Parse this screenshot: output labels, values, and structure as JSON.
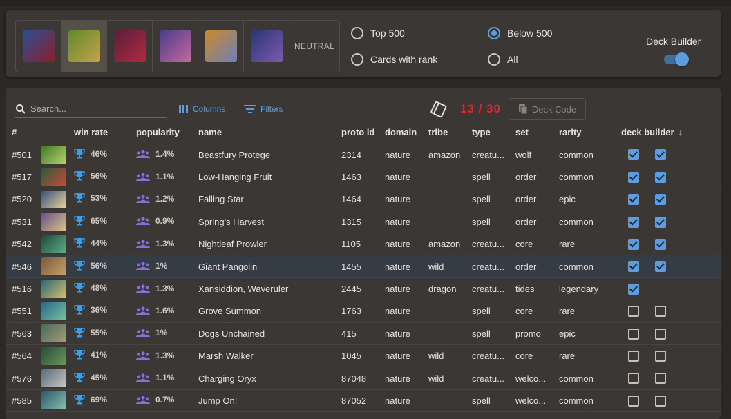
{
  "heroes": [
    {
      "name": "hero-1",
      "color": "#2b4f93",
      "color2": "#8a1e2a",
      "selected": false
    },
    {
      "name": "hero-2",
      "color": "#5f8a2e",
      "color2": "#c7a24a",
      "selected": true
    },
    {
      "name": "hero-3",
      "color": "#5a1f3a",
      "color2": "#b02a40",
      "selected": false
    },
    {
      "name": "hero-4",
      "color": "#4b3a8c",
      "color2": "#c46a9e",
      "selected": false
    },
    {
      "name": "hero-5",
      "color": "#c98a2a",
      "color2": "#6f7fb8",
      "selected": false
    },
    {
      "name": "hero-6",
      "color": "#2c3470",
      "color2": "#7a5bb0",
      "selected": false
    }
  ],
  "neutral_label": "NEUTRAL",
  "filters": {
    "top500": "Top 500",
    "below500": "Below 500",
    "cards_with_rank": "Cards with rank",
    "all": "All",
    "selected": "below500"
  },
  "deck_builder": {
    "title": "Deck Builder",
    "enabled": true
  },
  "toolbar": {
    "search_placeholder": "Search...",
    "columns_label": "Columns",
    "filters_label": "Filters",
    "deck_count": "13 / 30",
    "deck_code_label": "Deck Code"
  },
  "colors": {
    "accent": "#5b9de0",
    "count": "#e0262a",
    "trophy": "#3b9fe8",
    "people": "#8a6fd6"
  },
  "table": {
    "headers": {
      "num": "#",
      "win_rate": "win rate",
      "popularity": "popularity",
      "name": "name",
      "proto_id": "proto id",
      "domain": "domain",
      "tribe": "tribe",
      "type": "type",
      "set": "set",
      "rarity": "rarity",
      "deck_builder": "deck builder"
    },
    "rows": [
      {
        "num": "#501",
        "win": "46%",
        "pop": "1.4%",
        "name": "Beastfury Protege",
        "proto": "2314",
        "domain": "nature",
        "tribe": "amazon",
        "type": "creatu...",
        "set": "wolf",
        "rarity": "common",
        "cb1": true,
        "cb2": true,
        "c1": "#3f7a2a",
        "c2": "#b8d16a"
      },
      {
        "num": "#517",
        "win": "56%",
        "pop": "1.1%",
        "name": "Low-Hanging Fruit",
        "proto": "1463",
        "domain": "nature",
        "tribe": "",
        "type": "spell",
        "set": "order",
        "rarity": "common",
        "cb1": true,
        "cb2": true,
        "c1": "#2f5a3a",
        "c2": "#c94a3a"
      },
      {
        "num": "#520",
        "win": "53%",
        "pop": "1.2%",
        "name": "Falling Star",
        "proto": "1464",
        "domain": "nature",
        "tribe": "",
        "type": "spell",
        "set": "order",
        "rarity": "epic",
        "cb1": true,
        "cb2": true,
        "c1": "#3a4f7a",
        "c2": "#e8d79a"
      },
      {
        "num": "#531",
        "win": "65%",
        "pop": "0.9%",
        "name": "Spring's Harvest",
        "proto": "1315",
        "domain": "nature",
        "tribe": "",
        "type": "spell",
        "set": "order",
        "rarity": "common",
        "cb1": true,
        "cb2": true,
        "c1": "#6a4f8a",
        "c2": "#d9c38a"
      },
      {
        "num": "#542",
        "win": "44%",
        "pop": "1.3%",
        "name": "Nightleaf Prowler",
        "proto": "1105",
        "domain": "nature",
        "tribe": "amazon",
        "type": "creatu...",
        "set": "core",
        "rarity": "rare",
        "cb1": true,
        "cb2": true,
        "c1": "#1f4a3a",
        "c2": "#5fae8a"
      },
      {
        "num": "#546",
        "win": "56%",
        "pop": "1%",
        "name": "Giant Pangolin",
        "proto": "1455",
        "domain": "nature",
        "tribe": "wild",
        "type": "creatu...",
        "set": "order",
        "rarity": "common",
        "cb1": true,
        "cb2": true,
        "c1": "#7a5a3a",
        "c2": "#c9a06a",
        "hl": true
      },
      {
        "num": "#516",
        "win": "48%",
        "pop": "1.3%",
        "name": "Xansiddion, Waveruler",
        "proto": "2445",
        "domain": "nature",
        "tribe": "dragon",
        "type": "creatu...",
        "set": "tides",
        "rarity": "legendary",
        "cb1": true,
        "cb2": null,
        "c1": "#2a6a7a",
        "c2": "#d4c06a"
      },
      {
        "num": "#551",
        "win": "36%",
        "pop": "1.6%",
        "name": "Grove Summon",
        "proto": "1763",
        "domain": "nature",
        "tribe": "",
        "type": "spell",
        "set": "core",
        "rarity": "rare",
        "cb1": false,
        "cb2": false,
        "c1": "#2a6a8a",
        "c2": "#7ac0a0"
      },
      {
        "num": "#563",
        "win": "55%",
        "pop": "1%",
        "name": "Dogs Unchained",
        "proto": "415",
        "domain": "nature",
        "tribe": "",
        "type": "spell",
        "set": "promo",
        "rarity": "epic",
        "cb1": false,
        "cb2": false,
        "c1": "#4a6a5a",
        "c2": "#a89a7a"
      },
      {
        "num": "#564",
        "win": "41%",
        "pop": "1.3%",
        "name": "Marsh Walker",
        "proto": "1045",
        "domain": "nature",
        "tribe": "wild",
        "type": "creatu...",
        "set": "core",
        "rarity": "rare",
        "cb1": false,
        "cb2": false,
        "c1": "#2a4a3a",
        "c2": "#6a9a5a"
      },
      {
        "num": "#576",
        "win": "45%",
        "pop": "1.1%",
        "name": "Charging Oryx",
        "proto": "87048",
        "domain": "nature",
        "tribe": "wild",
        "type": "creatu...",
        "set": "welco...",
        "rarity": "common",
        "cb1": false,
        "cb2": false,
        "c1": "#5a6a7a",
        "c2": "#c8c8c0"
      },
      {
        "num": "#585",
        "win": "69%",
        "pop": "0.7%",
        "name": "Jump On!",
        "proto": "87052",
        "domain": "nature",
        "tribe": "",
        "type": "spell",
        "set": "welco...",
        "rarity": "common",
        "cb1": false,
        "cb2": false,
        "c1": "#2a5a6a",
        "c2": "#8ac0b0"
      }
    ]
  }
}
